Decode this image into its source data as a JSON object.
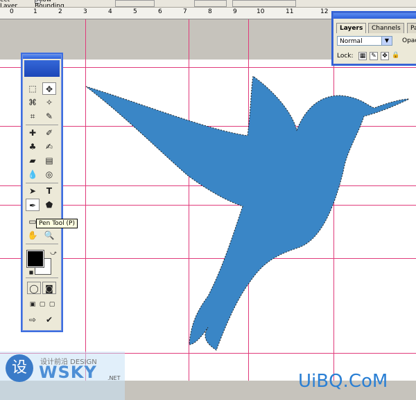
{
  "options_bar": {
    "auto_select_label": "ect Layer",
    "show_bounding_box_label": "Show Bounding Box"
  },
  "ruler": {
    "ticks": [
      "0",
      "1",
      "2",
      "3",
      "4",
      "5",
      "6",
      "7",
      "8",
      "9",
      "10",
      "11",
      "12"
    ]
  },
  "toolbox": {
    "tooltip": "Pen Tool (P)",
    "foreground_color": "#000000",
    "background_color": "#ffffff"
  },
  "layers_panel": {
    "tabs": [
      "Layers",
      "Channels",
      "Pa"
    ],
    "blend_mode": "Normal",
    "opacity_label": "Opac",
    "lock_label": "Lock:"
  },
  "canvas": {
    "shape_color": "#3a86c6",
    "guide_color": "#e03a7a"
  },
  "watermarks": {
    "left_char": "设",
    "left_design": "设计前沿 DESIGN",
    "left_brand": "WSKY",
    "left_net": ".NET",
    "right": "UiBQ.CoM"
  }
}
